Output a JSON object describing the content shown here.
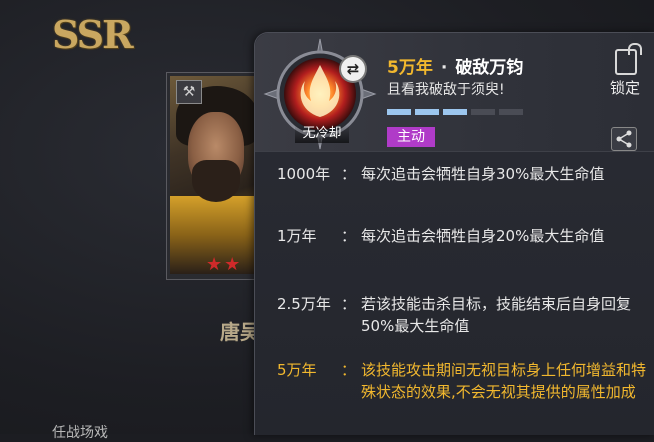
{
  "background": {
    "rarity": "SSR",
    "character_name": "唐吴",
    "bottom_label": "任战场戏"
  },
  "skill": {
    "emblem_badge": "无冷却",
    "tier": "5万年",
    "separator": "·",
    "name": "破敌万钧",
    "quote": "且看我破敌于须臾!",
    "progress": {
      "filled": 3,
      "total": 5
    },
    "type_tag": "主动",
    "lock_label": "锁定",
    "levels": [
      {
        "level": "1000年",
        "desc": "每次追击会牺牲自身30%最大生命值"
      },
      {
        "level": "1万年",
        "desc": "每次追击会牺牲自身20%最大生命值"
      },
      {
        "level": "2.5万年",
        "desc": "若该技能击杀目标，技能结束后自身回复50%最大生命值"
      },
      {
        "level": "5万年",
        "desc": "该技能攻击期间无视目标身上任何增益和特殊状态的效果,不会无视其提供的属性加成"
      }
    ]
  },
  "colors": {
    "gold": "#f2b82e",
    "active_tag": "#b03bc8",
    "progress_on": "#9cc6ee",
    "star_red": "#d02a2a"
  },
  "icons": [
    "swap-icon",
    "lock-icon",
    "share-icon",
    "class-icon",
    "star-icon",
    "flame-emblem-icon"
  ]
}
